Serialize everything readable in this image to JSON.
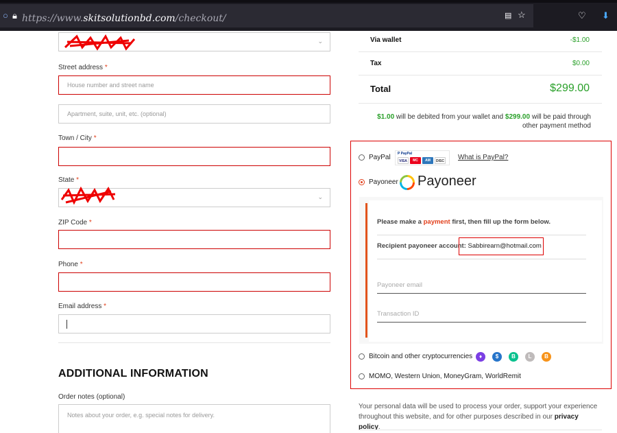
{
  "browser": {
    "url_prefix": "https://www.",
    "url_host": "skitsolutionbd.com",
    "url_path": "/checkout/"
  },
  "form": {
    "street_label": "Street address",
    "street_placeholder": "House number and street name",
    "apartment_placeholder": "Apartment, suite, unit, etc. (optional)",
    "town_label": "Town / City",
    "state_label": "State",
    "zip_label": "ZIP Code",
    "phone_label": "Phone",
    "email_label": "Email address",
    "required_mark": "*",
    "additional_heading": "ADDITIONAL INFORMATION",
    "notes_label": "Order notes (optional)",
    "notes_placeholder": "Notes about your order, e.g. special notes for delivery."
  },
  "summary": {
    "wallet_label": "Via wallet",
    "wallet_value": "-$1.00",
    "tax_label": "Tax",
    "tax_value": "$0.00",
    "total_label": "Total",
    "total_value": "$299.00",
    "note_amount1": "$1.00",
    "note_mid": " will be debited from your wallet and ",
    "note_amount2": "$299.00",
    "note_end": " will be paid through other payment method"
  },
  "payment": {
    "paypal_label": "PayPal",
    "paypal_link": "What is PayPal?",
    "payoneer_label": "Payoneer",
    "payoneer_logo": "Payoneer",
    "instruction_pre": "Please make a ",
    "instruction_link": "payment",
    "instruction_post": " first, then fill up the form below.",
    "recipient_label": "Recipient payoneer account: ",
    "recipient_value": "Sabbirearn@hotmail.com",
    "email_placeholder": "Payoneer email",
    "txn_placeholder": "Transaction ID",
    "crypto_label": "Bitcoin and other cryptocurrencies",
    "momo_label": "MOMO, Western Union, MoneyGram, WorldRemit",
    "selected": "Payoneer"
  },
  "privacy": {
    "text": "Your personal data will be used to process your order, support your experience throughout this website, and for other purposes described in our ",
    "link": "privacy policy",
    "end": "."
  },
  "colors": {
    "accent": "#e2401c",
    "error_border": "#cc0000",
    "price_green": "#2aa02a"
  }
}
